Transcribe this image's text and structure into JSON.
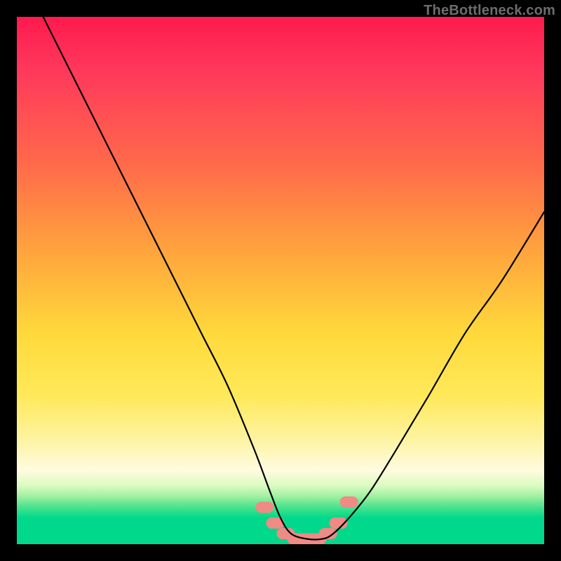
{
  "watermark": "TheBottleneck.com",
  "chart_data": {
    "type": "line",
    "title": "",
    "xlabel": "",
    "ylabel": "",
    "xlim": [
      0,
      100
    ],
    "ylim": [
      0,
      100
    ],
    "grid": false,
    "legend": false,
    "series": [
      {
        "name": "bottleneck-curve",
        "x": [
          5,
          10,
          15,
          20,
          25,
          30,
          35,
          40,
          45,
          48,
          50,
          52,
          55,
          58,
          60,
          63,
          67,
          72,
          78,
          85,
          92,
          100
        ],
        "values": [
          100,
          90,
          80,
          70,
          60,
          50,
          40,
          30,
          18,
          10,
          5,
          2,
          1,
          1,
          2,
          5,
          10,
          18,
          28,
          40,
          50,
          63
        ]
      }
    ],
    "markers": {
      "name": "sweet-spot-highlight",
      "color": "#ef8a85",
      "x": [
        47,
        49,
        51,
        53,
        55,
        57,
        59,
        61,
        63
      ],
      "values": [
        7,
        4,
        2,
        1,
        1,
        1,
        2,
        4,
        8
      ]
    },
    "gradient_stops": [
      {
        "pos": 0,
        "color": "#ff1a4d"
      },
      {
        "pos": 45,
        "color": "#ffa63d"
      },
      {
        "pos": 72,
        "color": "#ffe95a"
      },
      {
        "pos": 93,
        "color": "#00d98b"
      }
    ]
  }
}
